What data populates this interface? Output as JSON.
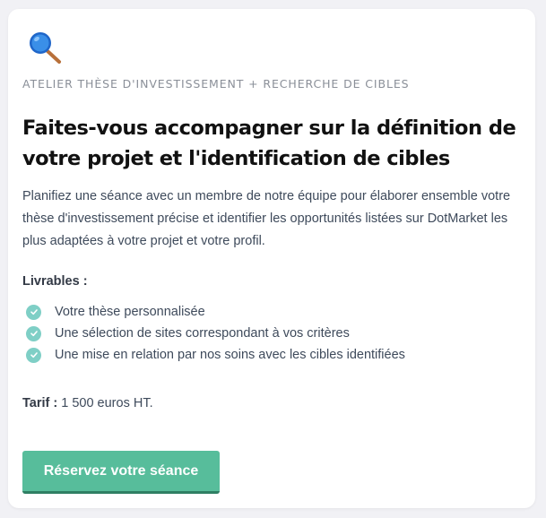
{
  "card": {
    "icon": "magnifying-glass-icon",
    "eyebrow": "ATELIER THÈSE D'INVESTISSEMENT + RECHERCHE DE CIBLES",
    "title": "Faites-vous accompagner sur la définition de votre projet et l'identification de cibles",
    "description": "Planifiez une séance avec un membre de notre équipe pour élaborer ensemble votre thèse d'investissement précise et identifier les opportunités listées sur DotMarket les plus adaptées à votre projet et votre profil.",
    "deliverables_label": "Livrables :",
    "deliverables": [
      "Votre thèse personnalisée",
      "Une sélection de sites correspondant à vos critères",
      "Une mise en relation par nos soins avec les cibles identifiées"
    ],
    "check_icon": "check-circle-icon",
    "price_label": "Tarif :",
    "price_value": "1 500 euros HT.",
    "cta_label": "Réservez votre séance"
  },
  "colors": {
    "page_bg": "#f1f1f5",
    "accent_green": "#57bd9b",
    "check_teal": "#7fcfc6",
    "title_text": "#111111",
    "body_text": "#3e4a5b"
  }
}
